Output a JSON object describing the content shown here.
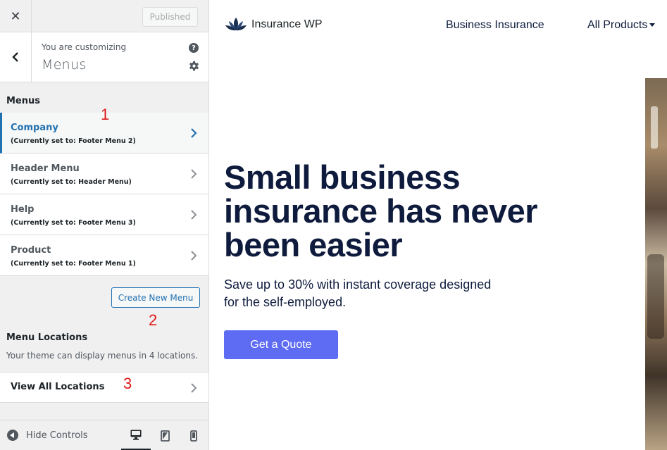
{
  "customizer": {
    "topbar": {
      "close_icon": "close-icon",
      "published_label": "Published"
    },
    "section": {
      "customizing_label": "You are customizing",
      "title": "Menus",
      "help_label": "?"
    },
    "menus_heading": "Menus",
    "menus": [
      {
        "name": "Company",
        "status": "(Currently set to: Footer Menu 2)",
        "active": true
      },
      {
        "name": "Header Menu",
        "status": "(Currently set to: Header Menu)",
        "active": false
      },
      {
        "name": "Help",
        "status": "(Currently set to: Footer Menu 3)",
        "active": false
      },
      {
        "name": "Product",
        "status": "(Currently set to: Footer Menu 1)",
        "active": false
      }
    ],
    "create_menu_label": "Create New Menu",
    "locations": {
      "heading": "Menu Locations",
      "description": "Your theme can display menus in 4 locations.",
      "view_all_label": "View All Locations"
    },
    "annotations": [
      "1",
      "2",
      "3"
    ],
    "footer": {
      "hide_controls_label": "Hide Controls",
      "devices": [
        "desktop",
        "tablet",
        "mobile"
      ],
      "active_device": "desktop"
    },
    "colors": {
      "accent": "#2271b1",
      "annotation": "#e01919"
    }
  },
  "preview": {
    "logo_text": "Insurance WP",
    "nav": [
      {
        "label": "Business Insurance"
      },
      {
        "label": "All Products"
      }
    ],
    "hero": {
      "title": "Small business insurance has never been easier",
      "subtitle": "Save up to 30% with instant coverage designed for the self-employed.",
      "cta_label": "Get a Quote"
    },
    "colors": {
      "cta": "#5e6cf3",
      "heading": "#0e1b3d"
    }
  }
}
